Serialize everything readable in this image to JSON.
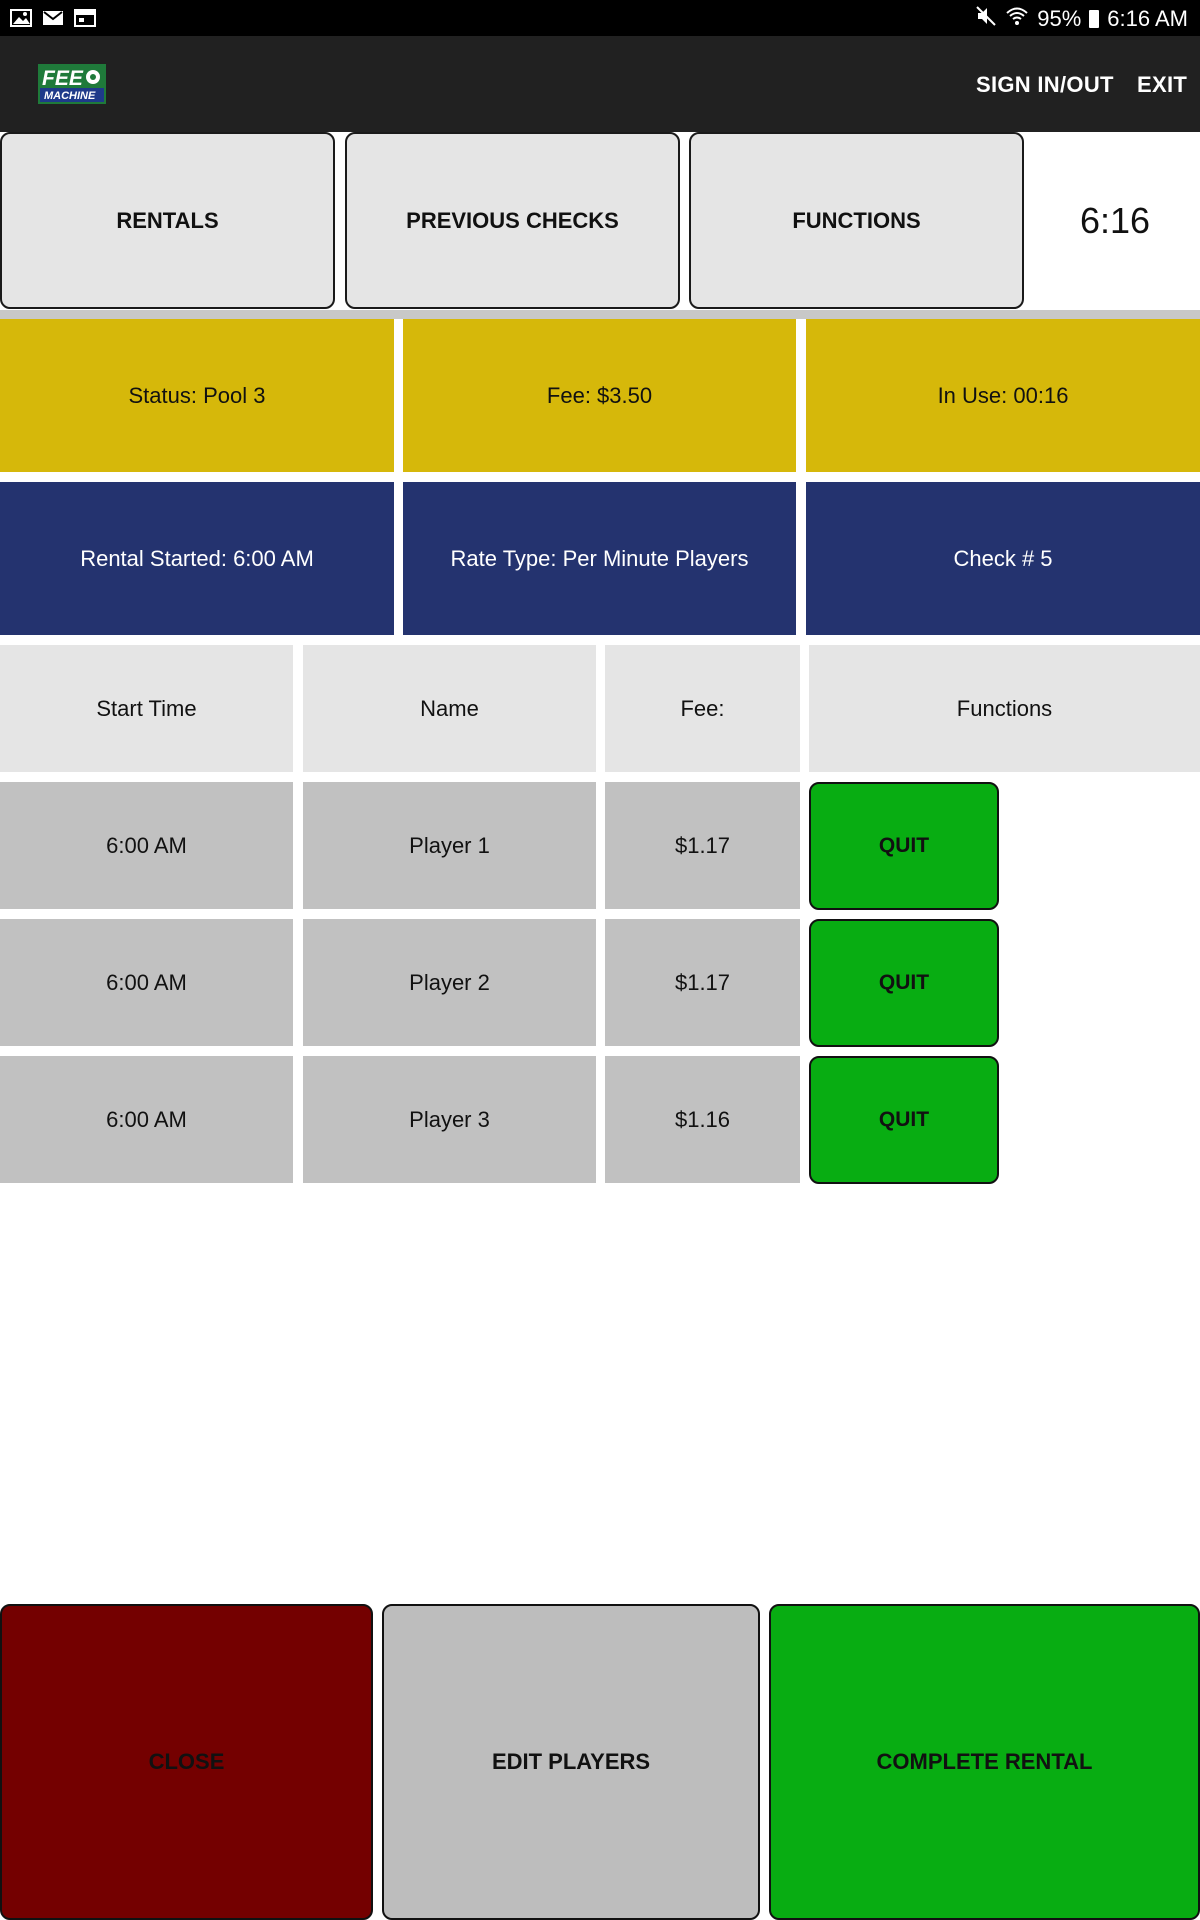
{
  "status_bar": {
    "icons_left": [
      "gallery-icon",
      "gmail-icon",
      "calendar-icon"
    ],
    "mute_icon": "mute-icon",
    "wifi_icon": "wifi-icon",
    "battery_percent": "95%",
    "time": "6:16 AM"
  },
  "app_bar": {
    "logo_line1": "FEE",
    "logo_line2": "MACHINE",
    "sign_in_out": "SIGN IN/OUT",
    "exit": "EXIT",
    "background": "#212121"
  },
  "nav": {
    "rentals": "RENTALS",
    "previous_checks": "PREVIOUS CHECKS",
    "functions": "FUNCTIONS",
    "clock": "6:16"
  },
  "info": {
    "status": "Status: Pool 3",
    "fee": "Fee: $3.50",
    "in_use": "In Use: 00:16",
    "rental_started": "Rental Started: 6:00 AM",
    "rate_type": "Rate Type: Per Minute Players",
    "check_number": "Check # 5",
    "yellow_color": "#d6b80a",
    "navy_color": "#24336f"
  },
  "table": {
    "headers": [
      "Start Time",
      "Name",
      "Fee:",
      "Functions"
    ],
    "rows": [
      {
        "start_time": "6:00 AM",
        "name": "Player 1",
        "fee": "$1.17",
        "action": "QUIT"
      },
      {
        "start_time": "6:00 AM",
        "name": "Player 2",
        "fee": "$1.17",
        "action": "QUIT"
      },
      {
        "start_time": "6:00 AM",
        "name": "Player 3",
        "fee": "$1.16",
        "action": "QUIT"
      }
    ]
  },
  "footer": {
    "close": "CLOSE",
    "edit_players": "EDIT PLAYERS",
    "complete_rental": "COMPLETE RENTAL",
    "close_color": "#740000",
    "edit_color": "#bdbdbd",
    "complete_color": "#08ad12"
  }
}
